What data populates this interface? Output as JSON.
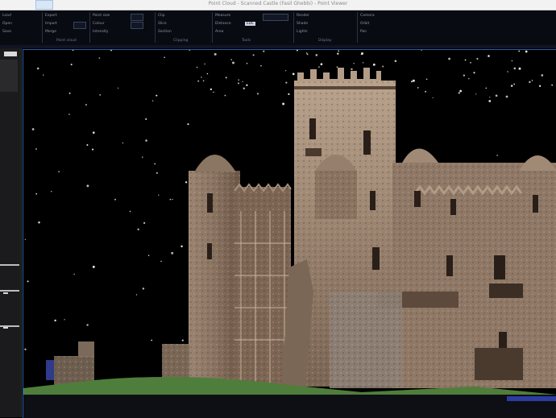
{
  "window": {
    "title": "Point Cloud - Scanned Castle (Fasil Ghebbi) - Point Viewer"
  },
  "ribbon": {
    "panels": [
      {
        "rows": [
          "Load",
          "Open",
          "Save"
        ],
        "caption": ""
      },
      {
        "rows": [
          "Export",
          "Import",
          "Merge"
        ],
        "caption": "Point cloud"
      },
      {
        "rows": [
          "Point size",
          "Colour",
          "Intensity"
        ],
        "caption": ""
      },
      {
        "rows": [
          "Clip",
          "Slice",
          "Section"
        ],
        "caption": "Clipping"
      },
      {
        "rows": [
          "Measure",
          "Distance",
          "Area"
        ],
        "caption": "Tools"
      },
      {
        "rows": [
          "Render",
          "Shade",
          "Lights"
        ],
        "caption": "Display"
      },
      {
        "rows": [
          "Camera",
          "Orbit",
          "Pan"
        ],
        "caption": "View"
      }
    ],
    "selected_option": "EDL"
  },
  "viewport": {
    "scene": "point-cloud-castle",
    "background": "#000000",
    "border": "#2a5ea8"
  },
  "colors": {
    "stone": "#8a7361",
    "stone_light": "#b29a85",
    "stone_dark": "#5a4637",
    "grass": "#4a7a38",
    "sky": "#000000"
  }
}
